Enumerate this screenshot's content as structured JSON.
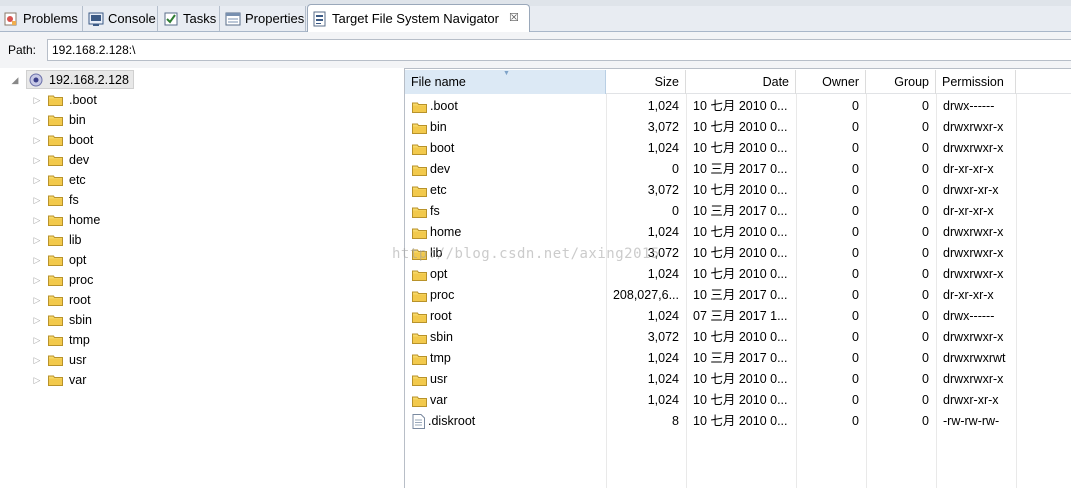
{
  "tabs": [
    {
      "label": "Problems",
      "icon": "problems-icon"
    },
    {
      "label": "Console",
      "icon": "console-icon"
    },
    {
      "label": "Tasks",
      "icon": "tasks-icon"
    },
    {
      "label": "Properties",
      "icon": "properties-icon"
    },
    {
      "label": "Target File System Navigator",
      "icon": "navigator-icon",
      "active": true,
      "close": "☒"
    }
  ],
  "path": {
    "label": "Path:",
    "value": "192.168.2.128:\\"
  },
  "tree": {
    "root": "192.168.2.128",
    "items": [
      ".boot",
      "bin",
      "boot",
      "dev",
      "etc",
      "fs",
      "home",
      "lib",
      "opt",
      "proc",
      "root",
      "sbin",
      "tmp",
      "usr",
      "var"
    ]
  },
  "table": {
    "headers": {
      "name": "File name",
      "size": "Size",
      "date": "Date",
      "owner": "Owner",
      "group": "Group",
      "permission": "Permission"
    },
    "rows": [
      {
        "name": ".boot",
        "type": "folder",
        "size": "1,024",
        "date": "10 七月 2010 0...",
        "owner": "0",
        "group": "0",
        "permission": "drwx------"
      },
      {
        "name": "bin",
        "type": "folder",
        "size": "3,072",
        "date": "10 七月 2010 0...",
        "owner": "0",
        "group": "0",
        "permission": "drwxrwxr-x"
      },
      {
        "name": "boot",
        "type": "folder",
        "size": "1,024",
        "date": "10 七月 2010 0...",
        "owner": "0",
        "group": "0",
        "permission": "drwxrwxr-x"
      },
      {
        "name": "dev",
        "type": "folder",
        "size": "0",
        "date": "10 三月 2017 0...",
        "owner": "0",
        "group": "0",
        "permission": "dr-xr-xr-x"
      },
      {
        "name": "etc",
        "type": "folder",
        "size": "3,072",
        "date": "10 七月 2010 0...",
        "owner": "0",
        "group": "0",
        "permission": "drwxr-xr-x"
      },
      {
        "name": "fs",
        "type": "folder",
        "size": "0",
        "date": "10 三月 2017 0...",
        "owner": "0",
        "group": "0",
        "permission": "dr-xr-xr-x"
      },
      {
        "name": "home",
        "type": "folder",
        "size": "1,024",
        "date": "10 七月 2010 0...",
        "owner": "0",
        "group": "0",
        "permission": "drwxrwxr-x"
      },
      {
        "name": "lib",
        "type": "folder",
        "size": "3,072",
        "date": "10 七月 2010 0...",
        "owner": "0",
        "group": "0",
        "permission": "drwxrwxr-x"
      },
      {
        "name": "opt",
        "type": "folder",
        "size": "1,024",
        "date": "10 七月 2010 0...",
        "owner": "0",
        "group": "0",
        "permission": "drwxrwxr-x"
      },
      {
        "name": "proc",
        "type": "folder",
        "size": "208,027,6...",
        "date": "10 三月 2017 0...",
        "owner": "0",
        "group": "0",
        "permission": "dr-xr-xr-x"
      },
      {
        "name": "root",
        "type": "folder",
        "size": "1,024",
        "date": "07 三月 2017 1...",
        "owner": "0",
        "group": "0",
        "permission": "drwx------"
      },
      {
        "name": "sbin",
        "type": "folder",
        "size": "3,072",
        "date": "10 七月 2010 0...",
        "owner": "0",
        "group": "0",
        "permission": "drwxrwxr-x"
      },
      {
        "name": "tmp",
        "type": "folder",
        "size": "1,024",
        "date": "10 三月 2017 0...",
        "owner": "0",
        "group": "0",
        "permission": "drwxrwxrwt"
      },
      {
        "name": "usr",
        "type": "folder",
        "size": "1,024",
        "date": "10 七月 2010 0...",
        "owner": "0",
        "group": "0",
        "permission": "drwxrwxr-x"
      },
      {
        "name": "var",
        "type": "folder",
        "size": "1,024",
        "date": "10 七月 2010 0...",
        "owner": "0",
        "group": "0",
        "permission": "drwxr-xr-x"
      },
      {
        "name": ".diskroot",
        "type": "file",
        "size": "8",
        "date": "10 七月 2010 0...",
        "owner": "0",
        "group": "0",
        "permission": "-rw-rw-rw-"
      }
    ]
  },
  "watermark": "http://blog.csdn.net/axing2015",
  "colors": {
    "folder": "#f2c94c",
    "selected_header": "#dce9f5",
    "tab_bar": "#e8ecf2"
  }
}
